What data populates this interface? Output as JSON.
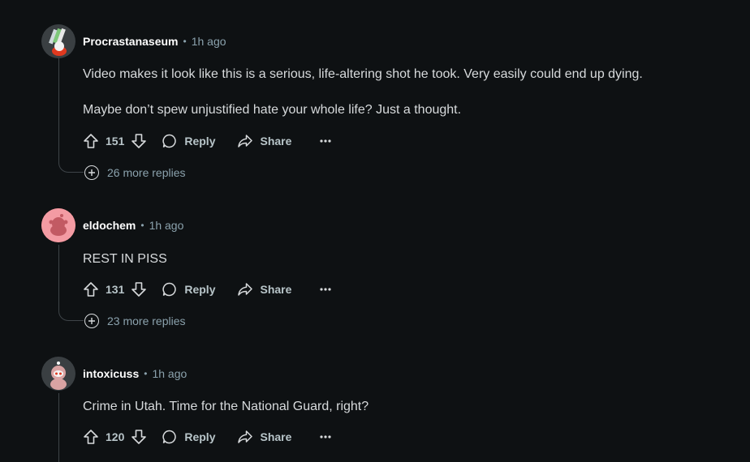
{
  "comments": [
    {
      "author": "Procrastanaseum",
      "time": "1h ago",
      "avatar_icon": "snoo-avatar-icon",
      "paragraphs": [
        "Video makes it look like this is a serious, life-altering shot he took. Very easily could end up dying.",
        "Maybe don’t spew unjustified hate your whole life? Just a thought."
      ],
      "score": "151",
      "reply_label": "Reply",
      "share_label": "Share",
      "more_replies": "26 more replies"
    },
    {
      "author": "eldochem",
      "time": "1h ago",
      "avatar_icon": "default-snoo-avatar-icon",
      "paragraphs": [
        "REST IN PISS"
      ],
      "score": "131",
      "reply_label": "Reply",
      "share_label": "Share",
      "more_replies": "23 more replies"
    },
    {
      "author": "intoxicuss",
      "time": "1h ago",
      "avatar_icon": "snoo-avatar-icon",
      "paragraphs": [
        "Crime in Utah. Time for the National Guard, right?"
      ],
      "score": "120",
      "reply_label": "Reply",
      "share_label": "Share"
    }
  ],
  "separator": "•",
  "colors": {
    "background": "#0e1113",
    "text": "#d7dadc",
    "muted": "#8ba2ad",
    "thread_line": "#3e4448"
  }
}
